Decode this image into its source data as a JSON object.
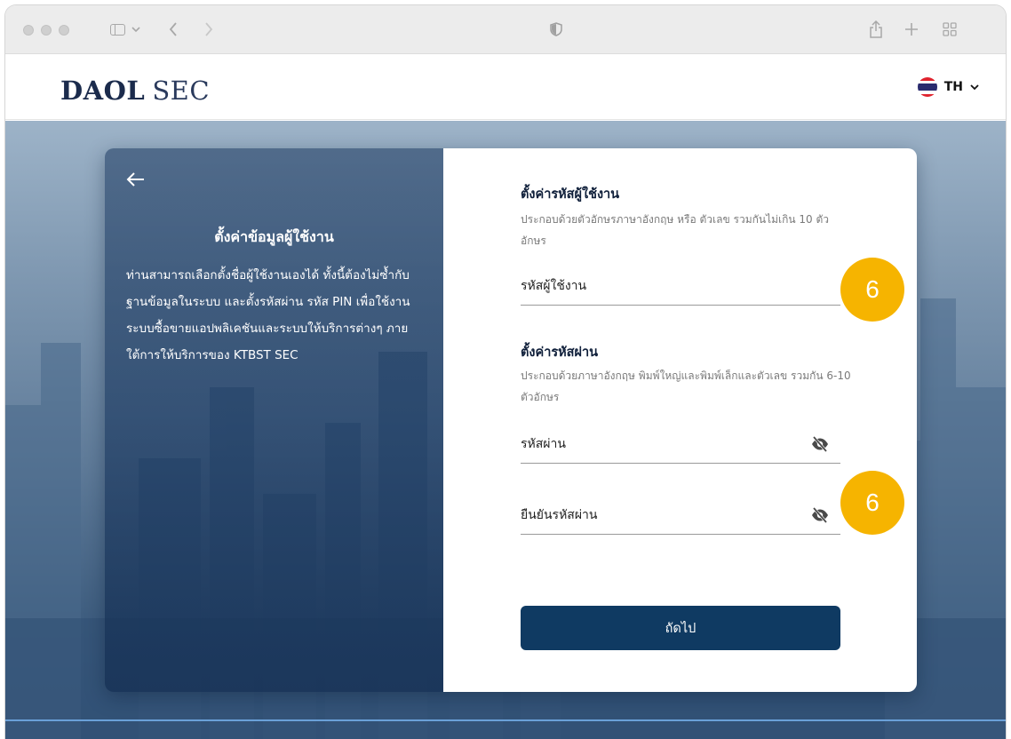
{
  "browser": {
    "icons": {
      "sidebar": "sidebar-icon",
      "back": "chevron-left-icon",
      "forward": "chevron-right-icon",
      "privacy": "shield-icon",
      "share": "share-icon",
      "new_tab": "plus-icon",
      "tab_overview": "grid-icon"
    }
  },
  "header": {
    "logo_bold": "DAOL",
    "logo_light": "SEC",
    "language": "TH"
  },
  "left_panel": {
    "title": "ตั้งค่าข้อมูลผู้ใช้งาน",
    "description": "ท่านสามารถเลือกตั้งชื่อผู้ใช้งานเองได้ ทั้งนี้ต้องไม่ซ้ำกับฐานข้อมูลในระบบ และตั้งรหัสผ่าน รหัส PIN เพื่อใช้งานระบบซื้อขายแอปพลิเคชันและระบบให้บริการต่างๆ ภายใต้การให้บริการของ KTBST SEC"
  },
  "form": {
    "username_section": {
      "title": "ตั้งค่ารหัสผู้ใช้งาน",
      "hint": "ประกอบด้วยตัวอักษรภาษาอังกฤษ หรือ ตัวเลข รวมกันไม่เกิน 10 ตัวอักษร",
      "placeholder": "รหัสผู้ใช้งาน"
    },
    "password_section": {
      "title": "ตั้งค่ารหัสผ่าน",
      "hint": "ประกอบด้วยภาษาอังกฤษ พิมพ์ใหญ่และพิมพ์เล็กและตัวเลข รวมกัน 6-10 ตัวอักษร",
      "password_placeholder": "รหัสผ่าน",
      "confirm_placeholder": "ยืนยันรหัสผ่าน"
    },
    "next_button": "ถัดไป"
  },
  "badges": [
    "6",
    "6"
  ],
  "colors": {
    "badge": "#f6b400",
    "button": "#0f3a62",
    "logo": "#1b2b4c"
  }
}
